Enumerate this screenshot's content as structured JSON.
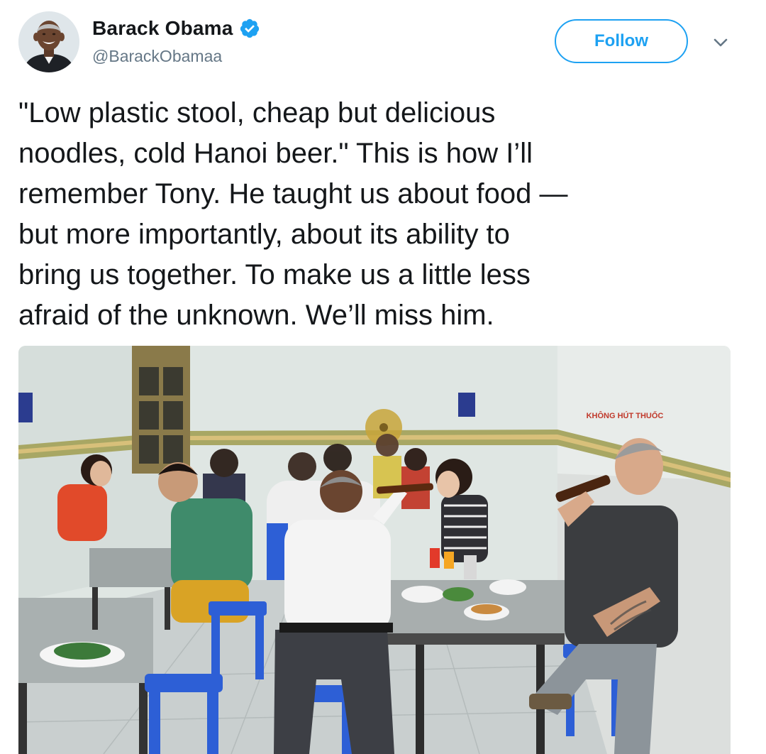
{
  "author": {
    "display_name": "Barack Obama",
    "handle": "@BarackObamaa",
    "verified": true
  },
  "actions": {
    "follow_label": "Follow",
    "menu_icon": "chevron-down-icon"
  },
  "tweet": {
    "text": "\"Low plastic stool, cheap but delicious\nnoodles, cold Hanoi beer.\" This is how I’ll\nremember Tony. He taught us about food —\nbut more importantly, about its ability to\nbring us together. To make us a little less\nafraid of the unknown. We’ll miss him."
  },
  "photo": {
    "wall_sign_text": "KHÔNG HÚT THUỐC"
  },
  "colors": {
    "accent": "#1da1f2",
    "text": "#14171a",
    "secondary": "#657786",
    "stool_blue": "#2d5fd6"
  }
}
